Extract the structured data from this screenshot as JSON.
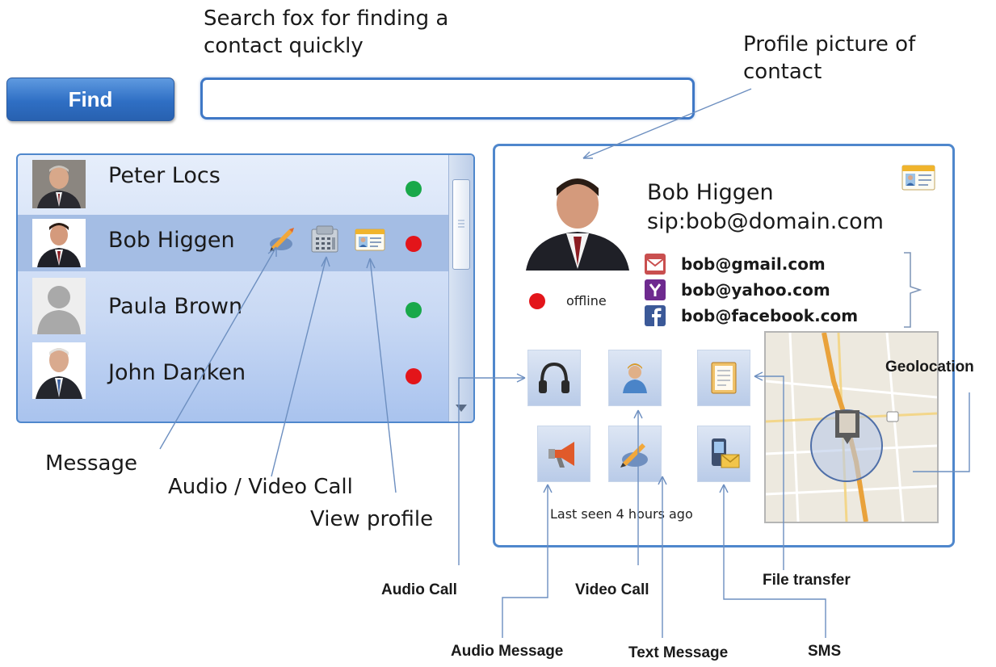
{
  "annotations": {
    "search_box": "Search fox for finding a\ncontact quickly",
    "profile_picture": "Profile picture of\ncontact",
    "message": "Message",
    "audio_video_call": "Audio / Video Call",
    "view_profile": "View profile",
    "geolocation": "Geolocation",
    "audio_call": "Audio Call",
    "video_call": "Video Call",
    "file_transfer": "File transfer",
    "audio_message": "Audio Message",
    "text_message": "Text Message",
    "sms": "SMS"
  },
  "search": {
    "button_label": "Find",
    "value": "",
    "placeholder": ""
  },
  "contacts": [
    {
      "name": "Peter Locs",
      "status": "online",
      "status_color": "#19a84a"
    },
    {
      "name": "Bob Higgen",
      "status": "offline",
      "status_color": "#e3151a",
      "selected": true,
      "row_icons": [
        "message-icon",
        "phone-icon",
        "profile-card-icon"
      ]
    },
    {
      "name": "Paula Brown",
      "status": "online",
      "status_color": "#19a84a"
    },
    {
      "name": "John Danken",
      "status": "offline",
      "status_color": "#e3151a"
    }
  ],
  "profile": {
    "name": "Bob Higgen",
    "sip": "sip:bob@domain.com",
    "status_label": "offline",
    "status_color": "#e3151a",
    "accounts": [
      {
        "service": "gmail",
        "icon": "gmail-icon",
        "address": "bob@gmail.com"
      },
      {
        "service": "yahoo",
        "icon": "yahoo-icon",
        "address": "bob@yahoo.com"
      },
      {
        "service": "facebook",
        "icon": "facebook-icon",
        "address": "bob@facebook.com"
      }
    ],
    "last_seen": "Last seen 4 hours ago",
    "actions": [
      "headset-icon",
      "video-person-icon",
      "document-icon",
      "megaphone-icon",
      "pencil-message-icon",
      "sms-phone-icon"
    ]
  },
  "colors": {
    "accent": "#4f87cc",
    "button": "#2f6fc4",
    "selected_row": "#a4bde4",
    "online": "#19a84a",
    "offline": "#e3151a"
  }
}
